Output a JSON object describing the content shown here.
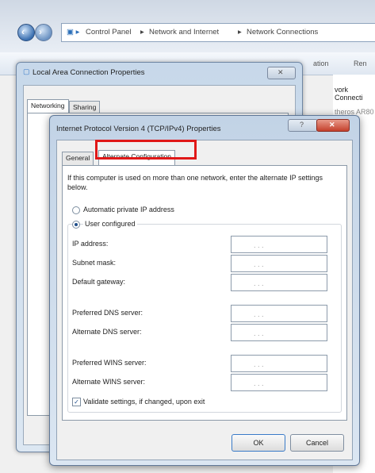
{
  "explorer": {
    "breadcrumb": [
      "Control Panel",
      "Network and Internet",
      "Network Connections"
    ],
    "toolbar_right_1": "ation",
    "toolbar_right_2": "Ren",
    "side_label_1": "vork Connecti",
    "side_label_2": "theros AR80"
  },
  "lac_window": {
    "title": "Local Area Connection Properties",
    "tabs": [
      "Networking",
      "Sharing"
    ]
  },
  "ipv4_window": {
    "title": "Internet Protocol Version 4 (TCP/IPv4) Properties",
    "tabs": [
      "General",
      "Alternate Configuration"
    ],
    "description": "If this computer is used on more than one network, enter the alternate IP settings below.",
    "radio_auto": "Automatic private IP address",
    "radio_user": "User configured",
    "fields": {
      "ip": "IP address:",
      "subnet": "Subnet mask:",
      "gateway": "Default gateway:",
      "pref_dns": "Preferred DNS server:",
      "alt_dns": "Alternate DNS server:",
      "pref_wins": "Preferred WINS server:",
      "alt_wins": "Alternate WINS server:"
    },
    "ip_dots": ".   .   .",
    "validate": "Validate settings, if changed, upon exit",
    "ok": "OK",
    "cancel": "Cancel"
  }
}
